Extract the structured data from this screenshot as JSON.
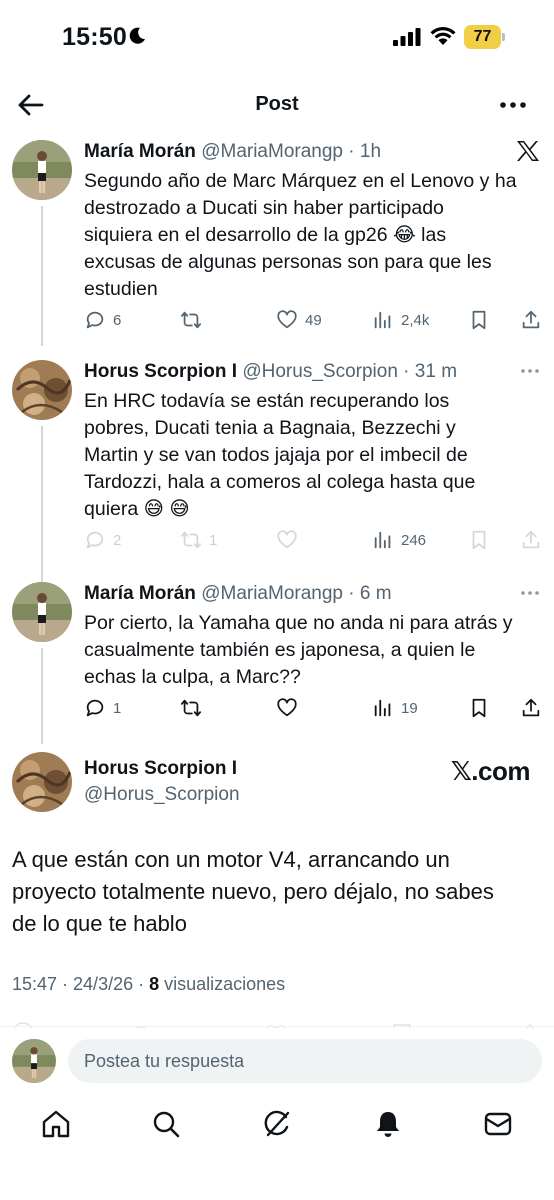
{
  "status_bar": {
    "time": "15:50",
    "battery": "77"
  },
  "header": {
    "title": "Post"
  },
  "tweets": [
    {
      "name": "María Morán",
      "handle": "@MariaMorangp",
      "sep": "·",
      "time": "1h",
      "text": "Segundo año de Marc Márquez en el Lenovo y ha\ndestrozado a Ducati sin haber participado\nsiquiera en el desarrollo de la gp26 😂 las\nexcusas de algunas personas son para que les\nestudien",
      "replies": "6",
      "reposts": "",
      "likes": "49",
      "views": "2,4k"
    },
    {
      "name": "Horus Scorpion I",
      "handle": "@Horus_Scorpion",
      "sep": "·",
      "time": "31 m",
      "text": "En HRC todavía se están recuperando los\npobres, Ducati tenia a Bagnaia, Bezzechi y\nMartin y se van todos jajaja por el imbecil de\nTardozzi, hala a comeros al colega hasta que\nquiera 😅 😅",
      "replies": "2",
      "reposts": "1",
      "likes": "",
      "views": "246"
    },
    {
      "name": "María Morán",
      "handle": "@MariaMorangp",
      "sep": "·",
      "time": "6 m",
      "text": "Por cierto, la Yamaha que no anda ni para atrás y\ncasualmente también es japonesa, a quien le\nechas la culpa, a Marc??",
      "replies": "1",
      "reposts": "",
      "likes": "",
      "views": "19"
    }
  ],
  "main_tweet": {
    "name": "Horus Scorpion I",
    "handle": "@Horus_Scorpion",
    "source": "𝕏.com",
    "text": "A que están con un motor V4, arrancando un\nproyecto totalmente nuevo, pero déjalo, no sabes\nde lo que te hablo",
    "timestamp": "15:47 · 24/3/26 · ",
    "views_count": "8",
    "views_label": " visualizaciones"
  },
  "reply_bar": {
    "placeholder": "Postea tu respuesta"
  },
  "bottom_nav": [
    "home-icon",
    "search-icon",
    "grok-icon",
    "notifications-icon",
    "messages-icon"
  ],
  "colors": {
    "text": "#0f1419",
    "secondary": "#536471",
    "thread_line": "#cfd9de",
    "battery": "#f0cf46"
  }
}
